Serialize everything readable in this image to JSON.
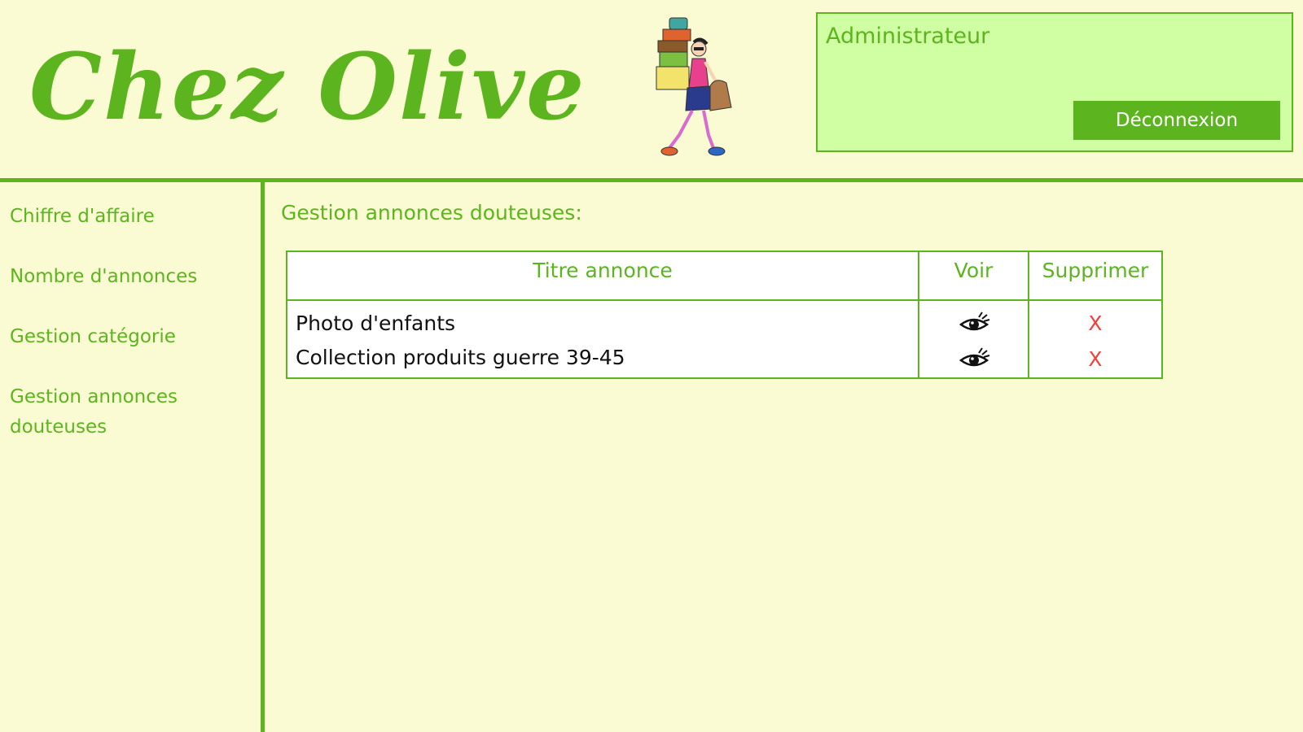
{
  "header": {
    "site_title": "Chez Olive",
    "user_role": "Administrateur",
    "logout_label": "Déconnexion"
  },
  "sidebar": {
    "items": [
      {
        "label": "Chiffre d'affaire"
      },
      {
        "label": "Nombre d'annonces"
      },
      {
        "label": "Gestion catégorie"
      },
      {
        "label": "Gestion annonces douteuses"
      }
    ]
  },
  "main": {
    "section_title": "Gestion annonces douteuses:",
    "table": {
      "headers": [
        "Titre annonce",
        "Voir",
        "Supprimer"
      ],
      "rows": [
        {
          "title": "Photo d'enfants",
          "view_icon": "eye-icon",
          "delete_label": "X"
        },
        {
          "title": "Collection produits guerre 39-45",
          "view_icon": "eye-icon",
          "delete_label": "X"
        }
      ]
    }
  },
  "colors": {
    "brand_green": "#5cb51e",
    "page_background": "#fafbd2",
    "admin_box_background": "#cfffa2",
    "delete_red": "#f0403a"
  }
}
